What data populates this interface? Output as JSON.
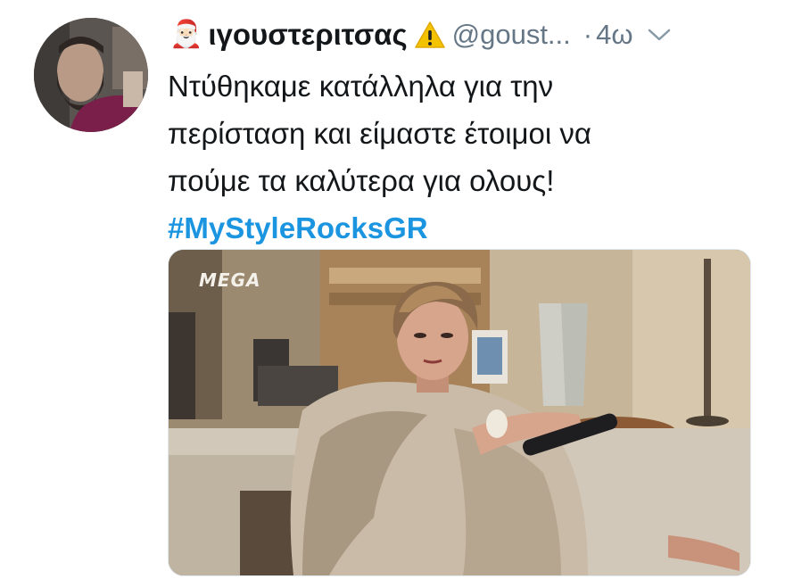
{
  "tweet": {
    "author": {
      "display_name": "ιγουστεριτσας",
      "handle": "@goust...",
      "emoji_prefix": "🎅🏻",
      "badge_icon": "warning-icon"
    },
    "separator": "·",
    "timestamp": "4ω",
    "text_lines": [
      "Ντύθηκαμε κατάλληλα για την",
      "περίσταση και είμαστε έτοιμοι να",
      "πούμε τα καλύτερα για ολους!"
    ],
    "hashtag": "#MyStyleRocksGR",
    "media": {
      "channel_logo": "MEGA"
    }
  },
  "colors": {
    "text": "#14171a",
    "secondary": "#657786",
    "link": "#1b95e0",
    "border": "#e1e8ed"
  }
}
